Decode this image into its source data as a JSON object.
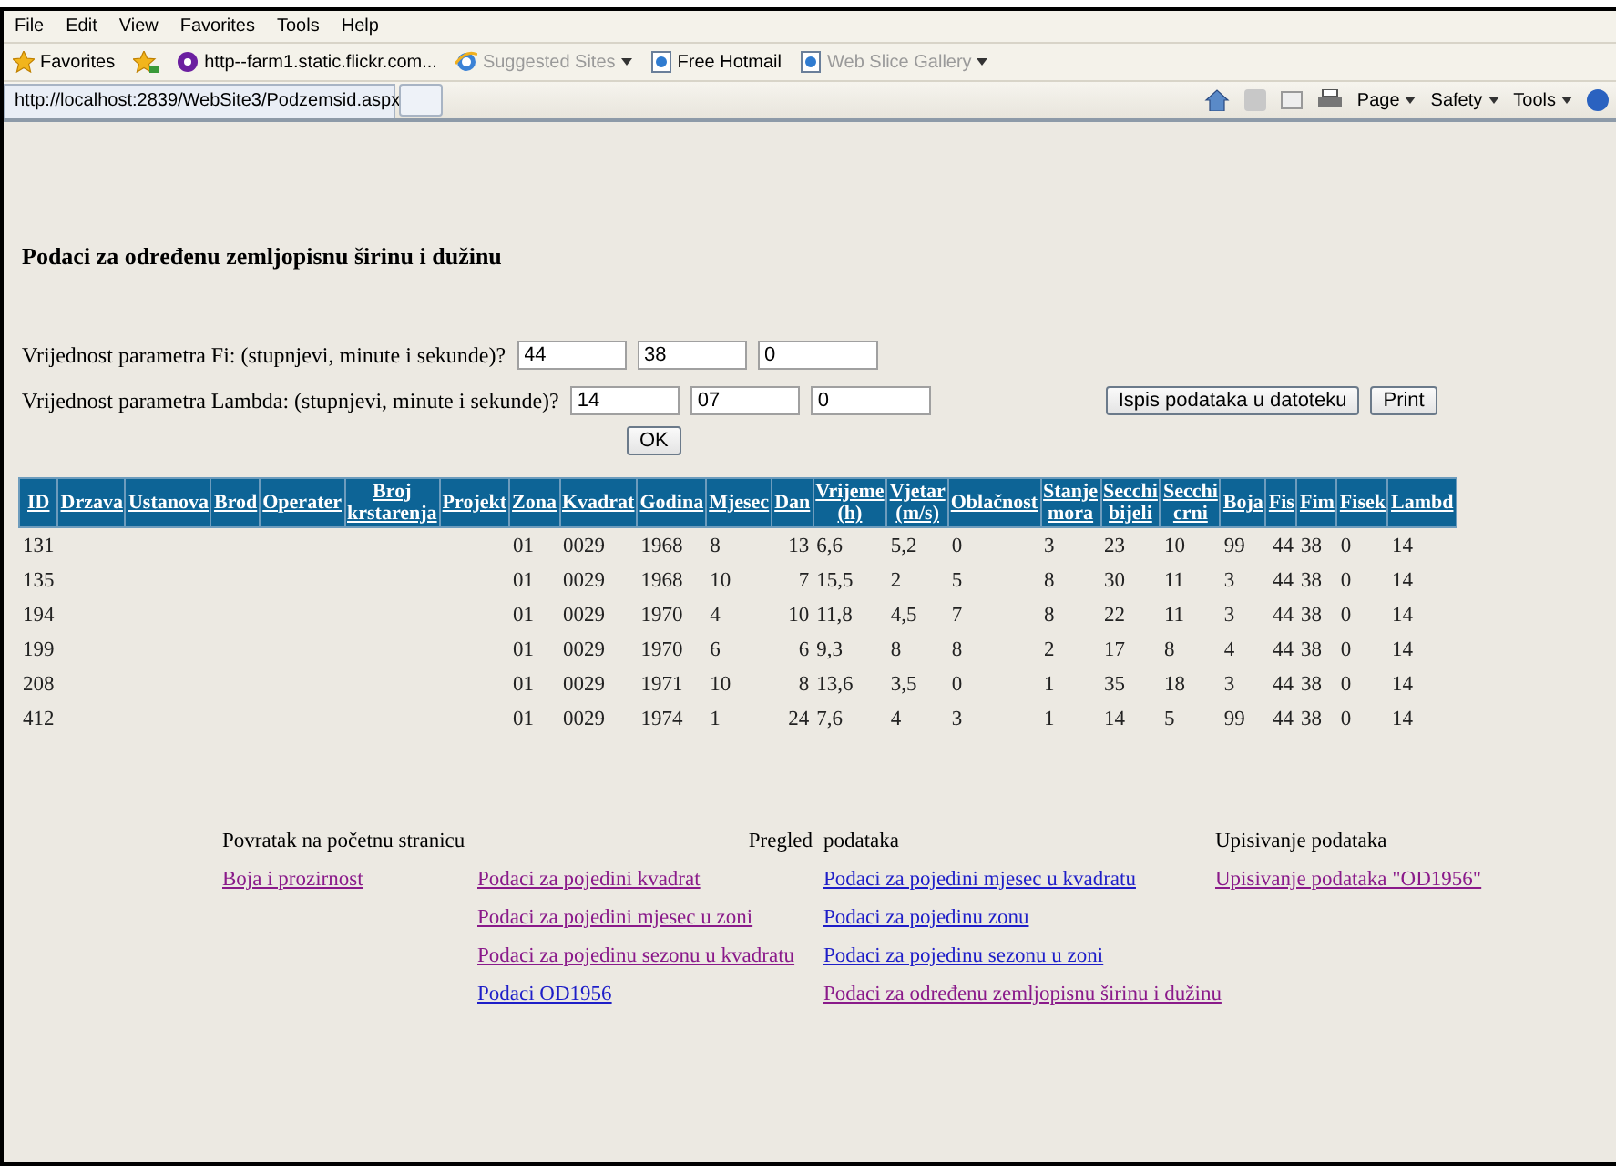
{
  "menu": [
    "File",
    "Edit",
    "View",
    "Favorites",
    "Tools",
    "Help"
  ],
  "favorites_bar": {
    "label": "Favorites",
    "items": [
      {
        "label": "http--farm1.static.flickr.com...",
        "disabled": false,
        "dropdown": false
      },
      {
        "label": "Suggested Sites",
        "disabled": true,
        "dropdown": true
      },
      {
        "label": "Free Hotmail",
        "disabled": false,
        "dropdown": false
      },
      {
        "label": "Web Slice Gallery",
        "disabled": true,
        "dropdown": true
      }
    ]
  },
  "tab": {
    "title": "http://localhost:2839/WebSite3/Podzemsid.aspx"
  },
  "command_bar": [
    "Page",
    "Safety",
    "Tools"
  ],
  "heading": "Podaci za određenu zemljopisnu širinu i dužinu",
  "params": [
    {
      "label": "Vrijednost parametra Fi: (stupnjevi, minute i sekunde)?",
      "values": [
        "44",
        "38",
        "0"
      ]
    },
    {
      "label": "Vrijednost parametra Lambda: (stupnjevi, minute i sekunde)?",
      "values": [
        "14",
        "07",
        "0"
      ]
    }
  ],
  "buttons": [
    {
      "label": "Ispis podataka u datoteku"
    },
    {
      "label": "Print"
    },
    {
      "label": "OK"
    }
  ],
  "table": {
    "columns": [
      {
        "label": "ID"
      },
      {
        "label": "Drzava"
      },
      {
        "label": "Ustanova"
      },
      {
        "label": "Brod"
      },
      {
        "label": "Operater"
      },
      {
        "label": "Broj krstarenja"
      },
      {
        "label": "Projekt"
      },
      {
        "label": "Zona"
      },
      {
        "label": "Kvadrat"
      },
      {
        "label": "Godina"
      },
      {
        "label": "Mjesec"
      },
      {
        "label": "Dan"
      },
      {
        "label": "Vrijeme (h)"
      },
      {
        "label": "Vjetar (m/s)"
      },
      {
        "label": "Oblačnost"
      },
      {
        "label": "Stanje mora"
      },
      {
        "label": "Secchi bijeli"
      },
      {
        "label": "Secchi crni"
      },
      {
        "label": "Boja"
      },
      {
        "label": "Fis"
      },
      {
        "label": "Fim"
      },
      {
        "label": "Fisek"
      },
      {
        "label": "Lambd"
      }
    ],
    "rows": [
      {
        "cells": [
          "131",
          null,
          null,
          null,
          null,
          null,
          null,
          "01",
          "0029",
          "1968",
          "8",
          "13",
          "6,6",
          "5,2",
          "0",
          "3",
          "23",
          "10",
          "99",
          "44",
          "38",
          "0",
          "14"
        ]
      },
      {
        "cells": [
          "135",
          null,
          null,
          null,
          null,
          null,
          null,
          "01",
          "0029",
          "1968",
          "10",
          "7",
          "15,5",
          "2",
          "5",
          "8",
          "30",
          "11",
          "3",
          "44",
          "38",
          "0",
          "14"
        ]
      },
      {
        "cells": [
          "194",
          null,
          null,
          null,
          null,
          null,
          null,
          "01",
          "0029",
          "1970",
          "4",
          "10",
          "11,8",
          "4,5",
          "7",
          "8",
          "22",
          "11",
          "3",
          "44",
          "38",
          "0",
          "14"
        ]
      },
      {
        "cells": [
          "199",
          null,
          null,
          null,
          null,
          null,
          null,
          "01",
          "0029",
          "1970",
          "6",
          "6",
          "9,3",
          "8",
          "8",
          "2",
          "17",
          "8",
          "4",
          "44",
          "38",
          "0",
          "14"
        ]
      },
      {
        "cells": [
          "208",
          null,
          null,
          null,
          null,
          null,
          null,
          "01",
          "0029",
          "1971",
          "10",
          "8",
          "13,6",
          "3,5",
          "0",
          "1",
          "35",
          "18",
          "3",
          "44",
          "38",
          "0",
          "14"
        ]
      },
      {
        "cells": [
          "412",
          null,
          null,
          null,
          null,
          null,
          null,
          "01",
          "0029",
          "1974",
          "1",
          "24",
          "7,6",
          "4",
          "3",
          "1",
          "14",
          "5",
          "99",
          "44",
          "38",
          "0",
          "14"
        ]
      }
    ]
  },
  "footer": {
    "headings": [
      "Povratak na početnu stranicu",
      "Pregled",
      "podataka",
      "Upisivanje podataka"
    ],
    "columns": [
      [
        {
          "label": "Boja i prozirnost",
          "visited": true
        }
      ],
      [
        {
          "label": "Podaci za pojedini kvadrat",
          "visited": true
        },
        {
          "label": "Podaci za pojedini mjesec u zoni",
          "visited": true
        },
        {
          "label": "Podaci za pojedinu sezonu u kvadratu",
          "visited": true
        },
        {
          "label": "Podaci OD1956",
          "visited": false
        }
      ],
      [
        {
          "label": "Podaci za pojedini mjesec u kvadratu",
          "visited": false
        },
        {
          "label": "Podaci za pojedinu zonu",
          "visited": false
        },
        {
          "label": "Podaci za pojedinu sezonu u zoni",
          "visited": false
        },
        {
          "label": "Podaci za određenu zemljopisnu širinu i dužinu",
          "visited": true
        }
      ],
      [
        {
          "label": "Upisivanje podataka \"OD1956\"",
          "visited": true
        }
      ]
    ]
  }
}
